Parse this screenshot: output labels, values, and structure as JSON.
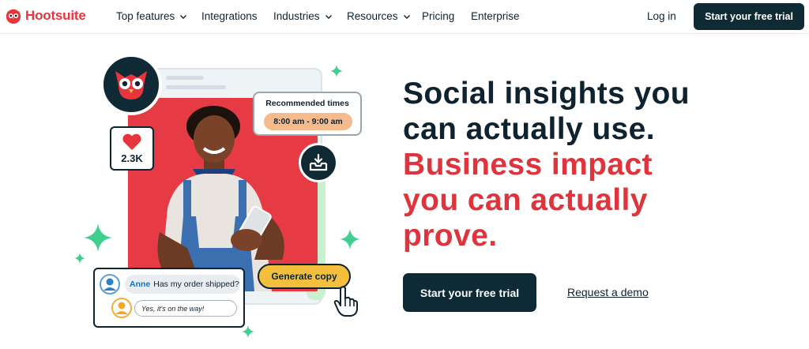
{
  "nav": {
    "logo_text": "Hootsuite",
    "items": [
      {
        "label": "Top features",
        "has_dropdown": true
      },
      {
        "label": "Integrations",
        "has_dropdown": false
      },
      {
        "label": "Industries",
        "has_dropdown": true
      },
      {
        "label": "Resources",
        "has_dropdown": true
      },
      {
        "label": "Pricing",
        "has_dropdown": false
      },
      {
        "label": "Enterprise",
        "has_dropdown": false
      }
    ],
    "login_label": "Log in",
    "cta_label": "Start your free trial"
  },
  "hero": {
    "headline_lines": [
      "Social insights you",
      "can actually use."
    ],
    "headline_red_lines": [
      "Business impact",
      "you can actually",
      "prove."
    ],
    "primary_cta": "Start your free trial",
    "secondary_link": "Request a demo"
  },
  "illustration": {
    "like_count": "2.3K",
    "recommended_title": "Recommended times",
    "recommended_time": "8:00 am - 9:00 am",
    "chat_name": "Anne",
    "chat_question": "Has my order shipped?",
    "chat_reply": "Yes, it's on the way!",
    "generate_button": "Generate copy"
  },
  "colors": {
    "brand_red": "#e8343d",
    "navy": "#0d2a35",
    "accent_orange": "#f6bb8c",
    "accent_yellow": "#f4bf3c",
    "sparkle_green": "#3fcf8e"
  }
}
